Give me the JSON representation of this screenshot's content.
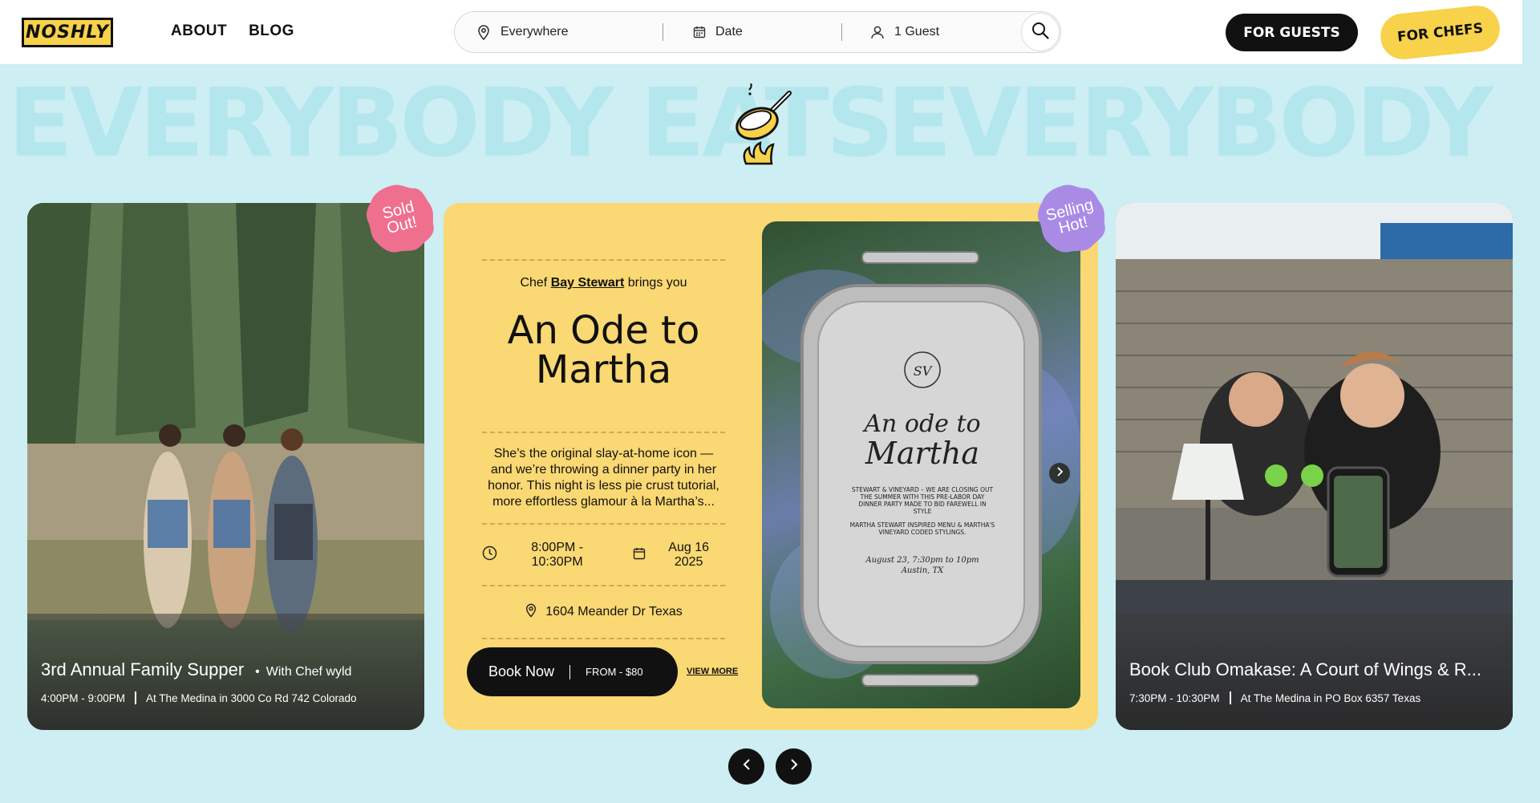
{
  "header": {
    "logo_text": "NOSHLY",
    "nav": [
      {
        "label": "ABOUT"
      },
      {
        "label": "BLOG"
      }
    ],
    "search": {
      "location": "Everywhere",
      "date": "Date",
      "guests": "1 Guest"
    },
    "for_guests": "FOR GUESTS",
    "for_chefs": "FOR CHEFS"
  },
  "marquee": {
    "text": "EVERYBODY EATS"
  },
  "cards": {
    "left": {
      "badge": "Sold Out!",
      "title": "3rd Annual Family Supper",
      "chef": "With Chef wyld",
      "time": "4:00PM - 9:00PM",
      "location": "At The Medina in 3000 Co Rd 742 Colorado"
    },
    "center": {
      "badge": "Selling Hot!",
      "brings_prefix": "Chef",
      "chef_name": "Bay Stewart",
      "brings_suffix": "brings you",
      "title": "An Ode to Martha",
      "description": "She’s the original slay-at-home icon — and we’re throwing a dinner party in her honor. This night is less pie crust tutorial, more effortless glamour à la Martha’s...",
      "time": "8:00PM - 10:30PM",
      "date": "Aug 16 2025",
      "address": "1604 Meander Dr Texas",
      "book_label": "Book Now",
      "price": "FROM - $80",
      "view_more": "VIEW MORE",
      "invite": {
        "monogram": "SV",
        "title_line1": "An ode to",
        "title_line2": "Martha",
        "body1": "STEWART & VINEYARD – WE ARE CLOSING OUT THE SUMMER WITH THIS PRE-LABOR DAY DINNER PARTY MADE TO BID FAREWELL IN STYLE",
        "body2": "MARTHA STEWART INSPIRED MENU & MARTHA'S VINEYARD CODED STYLINGS.",
        "date_line": "August 23, 7:30pm to 10pm",
        "place_line": "Austin, TX"
      }
    },
    "right": {
      "title": "Book Club Omakase: A Court of Wings & R...",
      "time": "7:30PM - 10:30PM",
      "location": "At The Medina in PO Box 6357 Texas"
    }
  },
  "colors": {
    "background": "#cdeef3",
    "accent_yellow": "#fad873",
    "badge_pink": "#ef6f8f",
    "badge_purple": "#a98be6",
    "dark": "#111111"
  },
  "icons": [
    "location-pin-icon",
    "calendar-icon",
    "user-icon",
    "search-icon",
    "clock-icon",
    "chevron-left-icon",
    "chevron-right-icon",
    "frying-pan-icon"
  ]
}
